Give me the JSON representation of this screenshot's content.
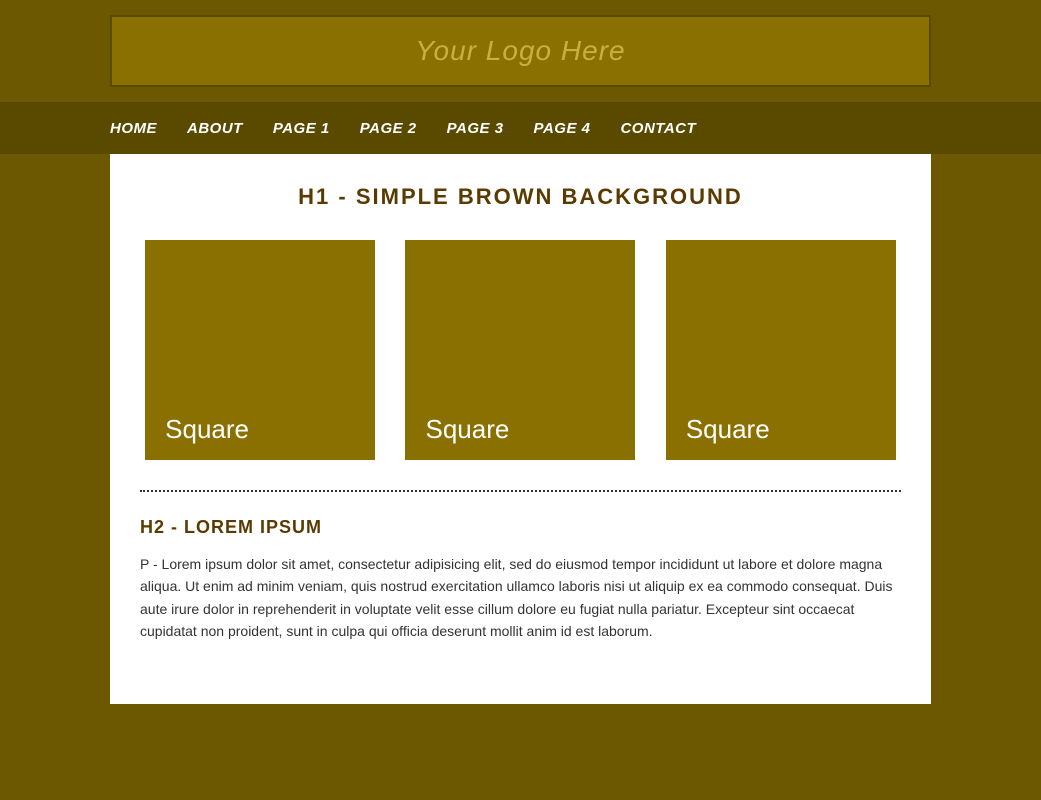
{
  "header": {
    "logo_text": "Your Logo Here"
  },
  "nav": {
    "items": [
      {
        "label": "HOME",
        "id": "home"
      },
      {
        "label": "ABOUT",
        "id": "about"
      },
      {
        "label": "PAGE 1",
        "id": "page1"
      },
      {
        "label": "PAGE 2",
        "id": "page2"
      },
      {
        "label": "PAGE 3",
        "id": "page3"
      },
      {
        "label": "PAGE 4",
        "id": "page4"
      },
      {
        "label": "CONTACT",
        "id": "contact"
      }
    ]
  },
  "main": {
    "page_title": "H1 - SIMPLE BROWN BACKGROUND",
    "squares": [
      {
        "label": "Square"
      },
      {
        "label": "Square"
      },
      {
        "label": "Square"
      }
    ],
    "h2_title": "H2 - LOREM IPSUM",
    "body_text": "P - Lorem ipsum dolor sit amet, consectetur adipisicing elit, sed do eiusmod tempor incididunt ut labore et dolore magna aliqua. Ut enim ad minim veniam, quis nostrud exercitation ullamco laboris nisi ut aliquip ex ea commodo consequat. Duis aute irure dolor in reprehenderit in voluptate velit esse cillum dolore eu fugiat nulla pariatur. Excepteur sint occaecat cupidatat non proident, sunt in culpa qui officia deserunt mollit anim id est laborum."
  }
}
